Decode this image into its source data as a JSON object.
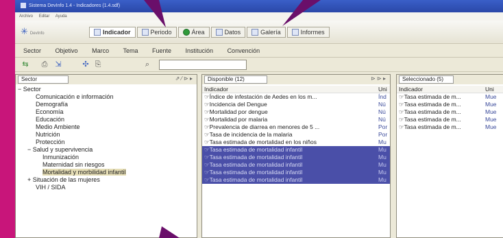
{
  "window": {
    "title": "Sistema DevInfo 1.4 - Indicadores (1.4.sdf)"
  },
  "menubar": [
    "Archivo",
    "Editar",
    "Ayuda"
  ],
  "logo": {
    "text": "DevInfo"
  },
  "tabs": [
    {
      "label": "Indicador",
      "icon": "indicator-icon"
    },
    {
      "label": "Periodo",
      "icon": "calendar-icon"
    },
    {
      "label": "Área",
      "icon": "globe-icon"
    },
    {
      "label": "Datos",
      "icon": "database-icon"
    },
    {
      "label": "Galería",
      "icon": "gallery-icon"
    },
    {
      "label": "Informes",
      "icon": "report-icon"
    }
  ],
  "nav": [
    "Sector",
    "Objetivo",
    "Marco",
    "Tema",
    "Fuente",
    "Institución",
    "Convención"
  ],
  "search": {
    "value": ""
  },
  "left_panel": {
    "title": "Sector",
    "tree": [
      {
        "label": "Sector",
        "level": 0
      },
      {
        "label": "Comunicación e información",
        "level": 1
      },
      {
        "label": "Demografía",
        "level": 1
      },
      {
        "label": "Economía",
        "level": 1
      },
      {
        "label": "Educación",
        "level": 1
      },
      {
        "label": "Medio Ambiente",
        "level": 1
      },
      {
        "label": "Nutrición",
        "level": 1
      },
      {
        "label": "Protección",
        "level": 1
      },
      {
        "label": "Salud y supervivencia",
        "level": 1
      },
      {
        "label": "Inmunización",
        "level": 2
      },
      {
        "label": "Maternidad sin riesgos",
        "level": 2
      },
      {
        "label": "Mortalidad y morbilidad infantil",
        "level": 2,
        "selected": true
      },
      {
        "label": "Situación de las mujeres",
        "level": 1
      },
      {
        "label": "VIH / SIDA",
        "level": 1
      }
    ]
  },
  "available_panel": {
    "title": "Disponible (12)",
    "columns": [
      "Indicador",
      "Uni"
    ],
    "rows": [
      {
        "indicator": "Índice de infestación de Aedes en los m...",
        "unit": "Índ"
      },
      {
        "indicator": "Incidencia del Dengue",
        "unit": "Nú"
      },
      {
        "indicator": "Mortalidad por dengue",
        "unit": "Nú"
      },
      {
        "indicator": "Mortalidad por malaria",
        "unit": "Nú"
      },
      {
        "indicator": "Prevalencia de diarrea en menores de 5 ...",
        "unit": "Por"
      },
      {
        "indicator": "Tasa de incidencia de la malaria",
        "unit": "Por"
      },
      {
        "indicator": "Tasa estimada de mortalidad en los niños",
        "unit": "Mu"
      },
      {
        "indicator": "Tasa estimada de mortalidad infantil",
        "unit": "Mu",
        "highlight": true
      },
      {
        "indicator": "Tasa estimada de mortalidad infantil",
        "unit": "Mu",
        "highlight": true
      },
      {
        "indicator": "Tasa estimada de mortalidad infantil",
        "unit": "Mu",
        "highlight": true
      },
      {
        "indicator": "Tasa estimada de mortalidad infantil",
        "unit": "Mu",
        "highlight": true
      },
      {
        "indicator": "Tasa estimada de mortalidad infantil",
        "unit": "Mu",
        "highlight": true
      }
    ]
  },
  "selected_panel": {
    "title": "Seleccionado (5)",
    "columns": [
      "Indicador",
      "Uni"
    ],
    "rows": [
      {
        "indicator": "Tasa estimada de m...",
        "unit": "Mue"
      },
      {
        "indicator": "Tasa estimada de m...",
        "unit": "Mue"
      },
      {
        "indicator": "Tasa estimada de m...",
        "unit": "Mue"
      },
      {
        "indicator": "Tasa estimada de m...",
        "unit": "Mue"
      },
      {
        "indicator": "Tasa estimada de m...",
        "unit": "Mue"
      }
    ]
  },
  "colors": {
    "background": "#c8157a",
    "pointer": "#6a0f6a",
    "highlight": "#4a4fa8",
    "tree_selected": "#e6deb6"
  }
}
